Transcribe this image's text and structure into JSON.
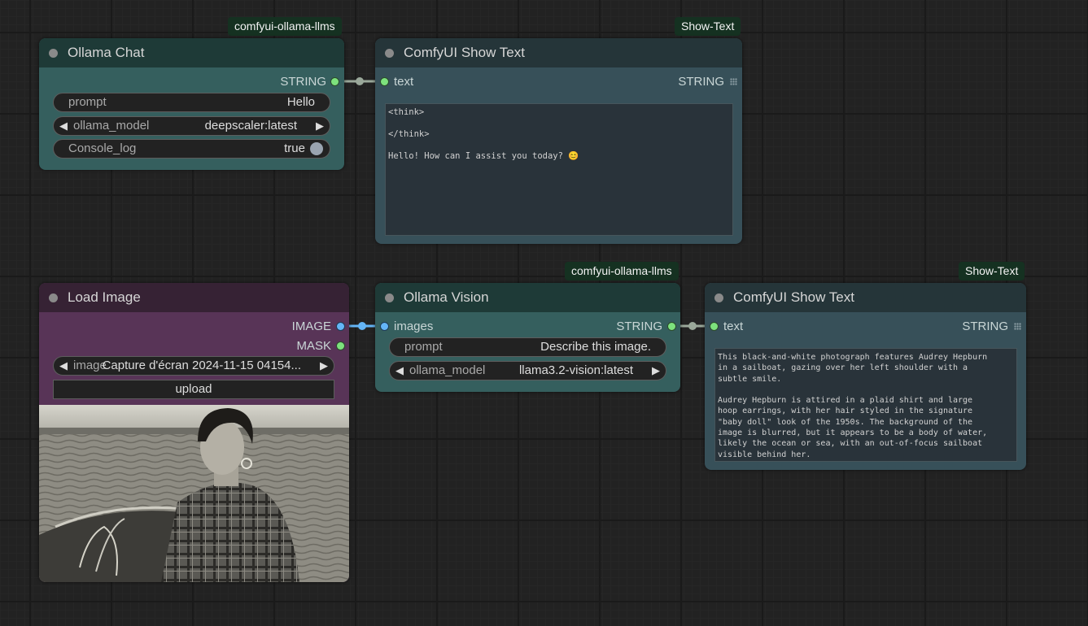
{
  "badges": {
    "ollama_chat": "comfyui-ollama-llms",
    "show_text_1": "Show-Text",
    "ollama_vision": "comfyui-ollama-llms",
    "show_text_2": "Show-Text"
  },
  "ollama_chat": {
    "title": "Ollama Chat",
    "output_label": "STRING",
    "prompt_label": "prompt",
    "prompt_value": "Hello",
    "model_label": "ollama_model",
    "model_value": "deepscaler:latest",
    "console_label": "Console_log",
    "console_value": "true"
  },
  "show_text_1": {
    "title": "ComfyUI Show Text",
    "input_label": "text",
    "output_label": "STRING",
    "content": "<think>\n\n</think>\n\nHello! How can I assist you today? 😊"
  },
  "load_image": {
    "title": "Load Image",
    "output_image": "IMAGE",
    "output_mask": "MASK",
    "image_label": "image",
    "image_value": "Capture d'écran 2024-11-15 04154...",
    "upload_label": "upload"
  },
  "ollama_vision": {
    "title": "Ollama Vision",
    "input_label": "images",
    "output_label": "STRING",
    "prompt_label": "prompt",
    "prompt_value": "Describe this image.",
    "model_label": "ollama_model",
    "model_value": "llama3.2-vision:latest"
  },
  "show_text_2": {
    "title": "ComfyUI Show Text",
    "input_label": "text",
    "output_label": "STRING",
    "content": "This black-and-white photograph features Audrey Hepburn\nin a sailboat, gazing over her left shoulder with a\nsubtle smile.\n\nAudrey Hepburn is attired in a plaid shirt and large\nhoop earrings, with her hair styled in the signature\n\"baby doll\" look of the 1950s. The background of the\nimage is blurred, but it appears to be a body of water,\nlikely the ocean or sea, with an out-of-focus sailboat\nvisible behind her."
  },
  "colors": {
    "string_link": "#9aa89a",
    "image_link": "#64b5f6",
    "badge_bg": "#153121"
  }
}
